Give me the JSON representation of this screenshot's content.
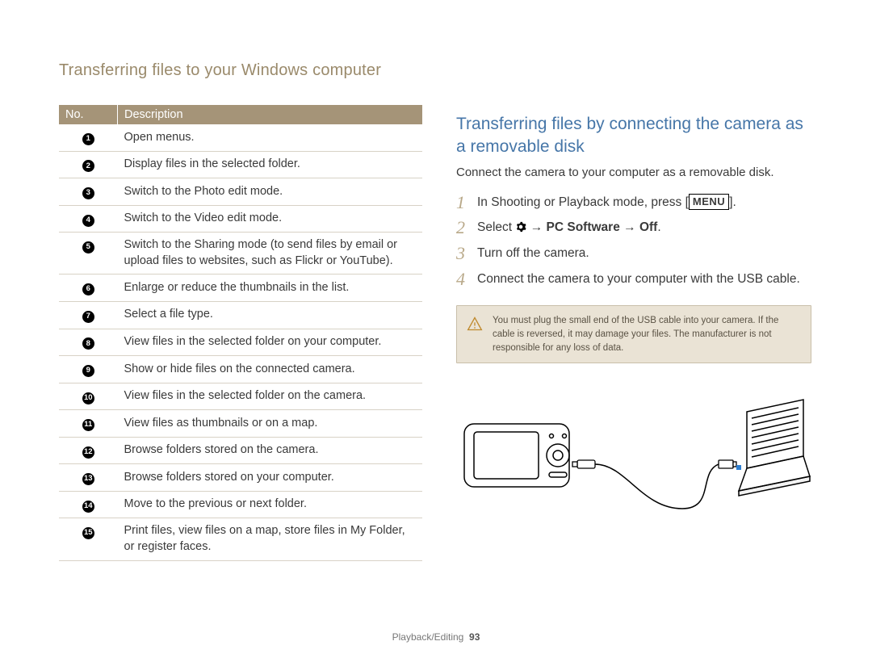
{
  "page_title": "Transferring files to your Windows computer",
  "table": {
    "head_no": "No.",
    "head_desc": "Description",
    "rows": [
      {
        "n": "1",
        "d": "Open menus."
      },
      {
        "n": "2",
        "d": "Display files in the selected folder."
      },
      {
        "n": "3",
        "d": "Switch to the Photo edit mode."
      },
      {
        "n": "4",
        "d": "Switch to the Video edit mode."
      },
      {
        "n": "5",
        "d": "Switch to the Sharing mode (to send files by email or upload files to websites, such as Flickr or YouTube)."
      },
      {
        "n": "6",
        "d": "Enlarge or reduce the thumbnails in the list."
      },
      {
        "n": "7",
        "d": "Select a file type."
      },
      {
        "n": "8",
        "d": "View files in the selected folder on your computer."
      },
      {
        "n": "9",
        "d": "Show or hide files on the connected camera."
      },
      {
        "n": "10",
        "d": "View files in the selected folder on the camera."
      },
      {
        "n": "11",
        "d": "View files as thumbnails or on a map."
      },
      {
        "n": "12",
        "d": "Browse folders stored on the camera."
      },
      {
        "n": "13",
        "d": "Browse folders stored on your computer."
      },
      {
        "n": "14",
        "d": "Move to the previous or next folder."
      },
      {
        "n": "15",
        "d": "Print files, view files on a map, store files in My Folder, or register faces."
      }
    ]
  },
  "section_heading": "Transferring files by connecting the camera as a removable disk",
  "intro": "Connect the camera to your computer as a removable disk.",
  "steps": {
    "s1_pre": "In Shooting or Playback mode, press [",
    "s1_menu": "MENU",
    "s1_post": "].",
    "s2_pre": "Select ",
    "s2_arrow": " → ",
    "s2_a": "PC Software",
    "s2_b": "Off",
    "s2_period": ".",
    "s3": "Turn off the camera.",
    "s4": "Connect the camera to your computer with the USB cable."
  },
  "note": "You must plug the small end of the USB cable into your camera. If the cable is reversed, it may damage your files. The manufacturer is not responsible for any loss of data.",
  "footer_section": "Playback/Editing",
  "footer_page": "93"
}
